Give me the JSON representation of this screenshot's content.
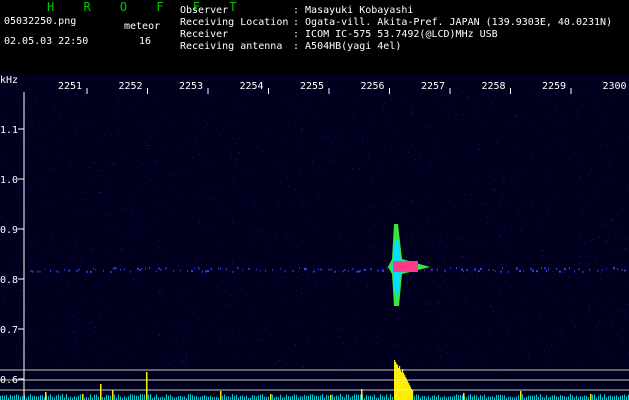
{
  "header": {
    "brand": "H R O F F T",
    "filename": "05032250.png",
    "meteor_label": "meteor",
    "datetime": "02.05.03 22:50",
    "meteor_count": "16"
  },
  "info": [
    {
      "key": "Observer",
      "value": ": Masayuki Kobayashi"
    },
    {
      "key": "Receiving Location",
      "value": ": Ogata-vill. Akita-Pref. JAPAN (139.9303E, 40.0231N)"
    },
    {
      "key": "Receiver",
      "value": ": ICOM IC-575 53.7492(@LCD)MHz USB"
    },
    {
      "key": "Receiving antenna",
      "value": ": A504HB(yagi 4el)"
    }
  ],
  "plot": {
    "y_unit": "kHz",
    "time_ticks": [
      "2251",
      "2252",
      "2253",
      "2254",
      "2255",
      "2256",
      "2257",
      "2258",
      "2259",
      "2300"
    ],
    "freq_ticks": [
      "1.1",
      "1.0",
      "0.9",
      "0.8",
      "0.7",
      "0.6"
    ],
    "colors": {
      "background": "#00001e",
      "noise": "#1a2a7a",
      "trace": "#3050ff",
      "echo_core": "#ff3a8a",
      "echo_mid": "#00e0ff",
      "echo_outer": "#40ff40",
      "bars": "#ffee00",
      "baseline": "#00ffff",
      "guide": "#e8e8c8"
    }
  }
}
